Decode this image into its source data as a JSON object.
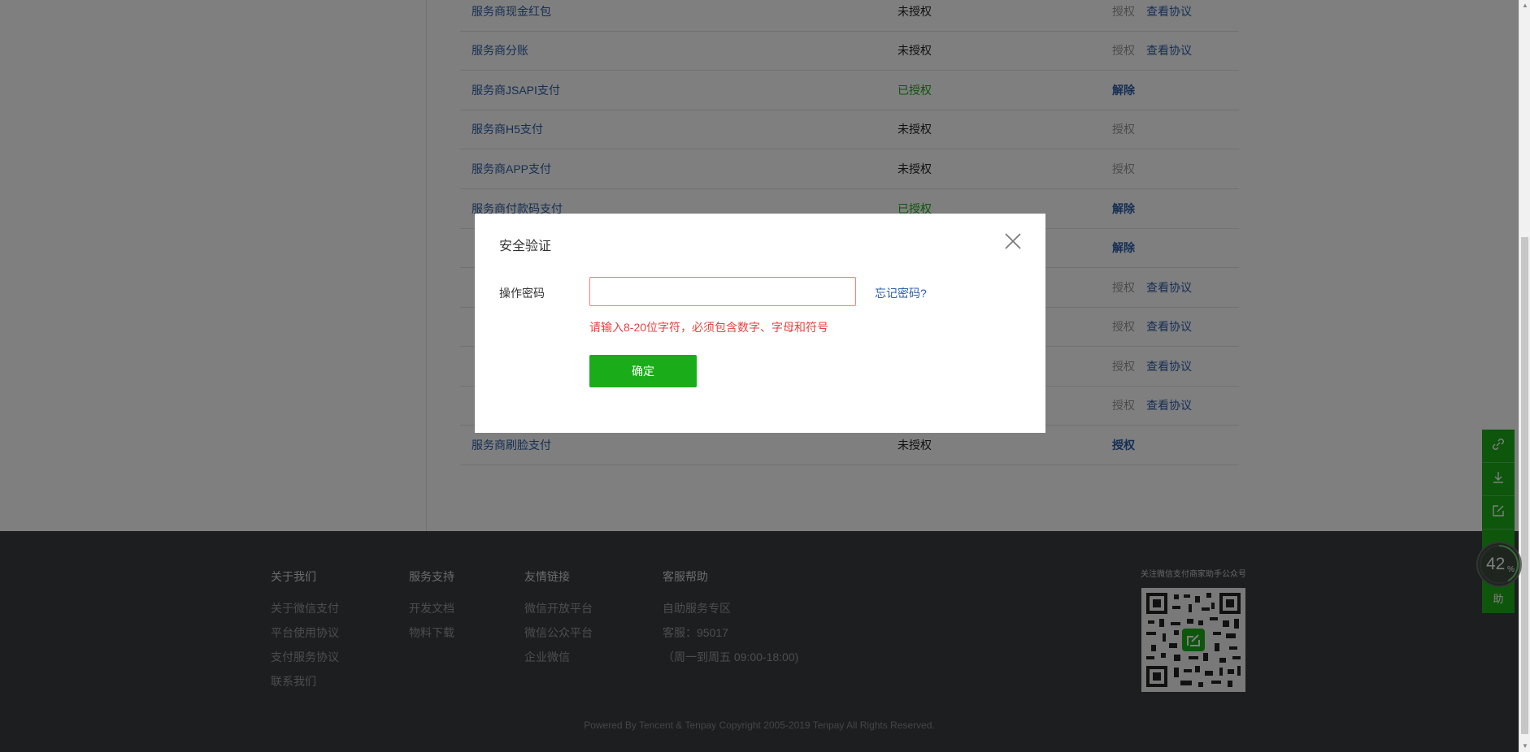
{
  "permissions": {
    "rows": [
      {
        "name": "服务商现金红包",
        "status": "未授权",
        "action": "授权",
        "agreement": "查看协议"
      },
      {
        "name": "服务商分账",
        "status": "未授权",
        "action": "授权",
        "agreement": "查看协议"
      },
      {
        "name": "服务商JSAPI支付",
        "status": "已授权",
        "action": "解除",
        "agreement": ""
      },
      {
        "name": "服务商H5支付",
        "status": "未授权",
        "action": "授权",
        "agreement": ""
      },
      {
        "name": "服务商APP支付",
        "status": "未授权",
        "action": "授权",
        "agreement": ""
      },
      {
        "name": "服务商付款码支付",
        "status": "已授权",
        "action": "解除",
        "agreement": ""
      },
      {
        "name": "",
        "status": "",
        "action": "解除",
        "agreement": ""
      },
      {
        "name": "",
        "status": "",
        "action": "授权",
        "agreement": "查看协议"
      },
      {
        "name": "",
        "status": "",
        "action": "授权",
        "agreement": "查看协议"
      },
      {
        "name": "",
        "status": "",
        "action": "授权",
        "agreement": "查看协议"
      },
      {
        "name": "",
        "status": "",
        "action": "授权",
        "agreement": "查看协议"
      },
      {
        "name": "服务商刷脸支付",
        "status": "未授权",
        "action": "授权",
        "agreement": ""
      }
    ]
  },
  "modal": {
    "title": "安全验证",
    "field_label": "操作密码",
    "password_value": "",
    "forgot_link": "忘记密码?",
    "error_text": "请输入8-20位字符，必须包含数字、字母和符号",
    "confirm_label": "确定"
  },
  "footer": {
    "columns": [
      {
        "heading": "关于我们",
        "links": [
          "关于微信支付",
          "平台使用协议",
          "支付服务协议",
          "联系我们"
        ]
      },
      {
        "heading": "服务支持",
        "links": [
          "开发文档",
          "物料下载"
        ]
      },
      {
        "heading": "友情链接",
        "links": [
          "微信开放平台",
          "微信公众平台",
          "企业微信"
        ]
      },
      {
        "heading": "客服帮助",
        "links": [
          "自助服务专区",
          "客服：95017",
          "（周一到周五 09:00-18:00)"
        ]
      }
    ],
    "qr_title": "关注微信支付商家助手公众号",
    "copyright": "Powered By Tencent & Tenpay    Copyright 2005-2019 Tenpay All Rights Reserved."
  },
  "sidebar_tools": {
    "icons": [
      "link-icon",
      "download-icon",
      "edit-icon"
    ],
    "help_text_partial": "助"
  },
  "gauge": {
    "value": "42",
    "unit": "%"
  },
  "colors": {
    "brand_green": "#1aad19",
    "link_blue": "#2b5ea8",
    "error_red": "#e64340",
    "footer_bg": "#3a3d3e"
  }
}
